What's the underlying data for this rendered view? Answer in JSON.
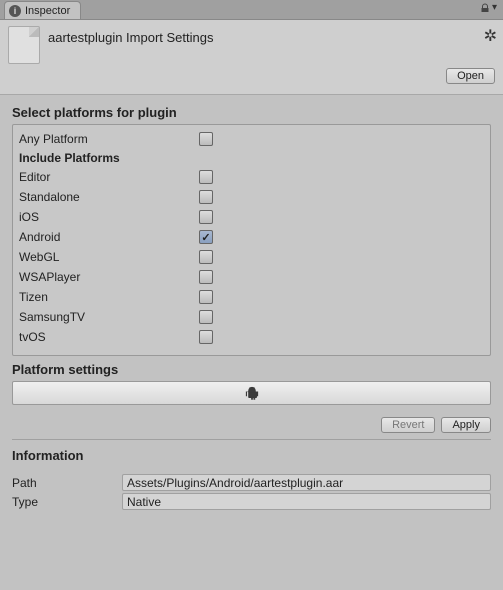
{
  "tab": {
    "title": "Inspector"
  },
  "header": {
    "title": "aartestplugin Import Settings",
    "open_label": "Open"
  },
  "platforms": {
    "title": "Select platforms for plugin",
    "any_label": "Any Platform",
    "any_checked": false,
    "include_title": "Include Platforms",
    "items": [
      {
        "label": "Editor",
        "checked": false
      },
      {
        "label": "Standalone",
        "checked": false
      },
      {
        "label": "iOS",
        "checked": false
      },
      {
        "label": "Android",
        "checked": true
      },
      {
        "label": "WebGL",
        "checked": false
      },
      {
        "label": "WSAPlayer",
        "checked": false
      },
      {
        "label": "Tizen",
        "checked": false
      },
      {
        "label": "SamsungTV",
        "checked": false
      },
      {
        "label": "tvOS",
        "checked": false
      }
    ]
  },
  "platform_settings": {
    "title": "Platform settings",
    "selected_icon": "android"
  },
  "buttons": {
    "revert": "Revert",
    "apply": "Apply"
  },
  "information": {
    "title": "Information",
    "path_label": "Path",
    "path_value": "Assets/Plugins/Android/aartestplugin.aar",
    "type_label": "Type",
    "type_value": "Native"
  }
}
